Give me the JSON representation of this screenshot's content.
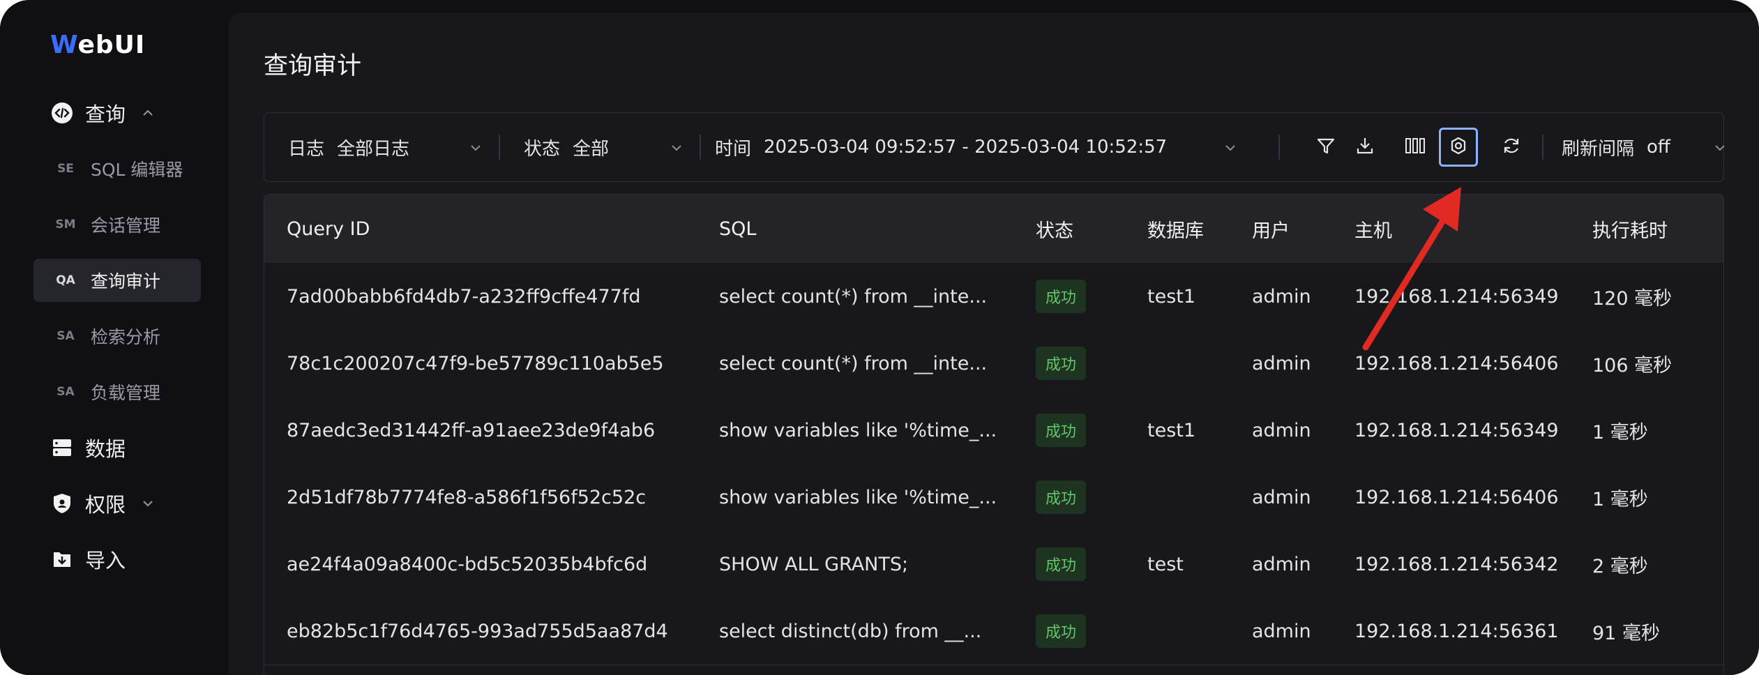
{
  "app": {
    "logo_first": "W",
    "logo_rest": "ebUI"
  },
  "sidebar": {
    "items": [
      {
        "label": "查询"
      },
      {
        "abbr": "SE",
        "label": "SQL 编辑器"
      },
      {
        "abbr": "SM",
        "label": "会话管理"
      },
      {
        "abbr": "QA",
        "label": "查询审计"
      },
      {
        "abbr": "SA",
        "label": "检索分析"
      },
      {
        "abbr": "SA",
        "label": "负载管理"
      },
      {
        "label": "数据"
      },
      {
        "label": "权限"
      },
      {
        "label": "导入"
      }
    ]
  },
  "page": {
    "title": "查询审计"
  },
  "toolbar": {
    "log_label": "日志",
    "log_value": "全部日志",
    "status_label": "状态",
    "status_value": "全部",
    "time_label": "时间",
    "time_value": "2025-03-04 09:52:57 - 2025-03-04 10:52:57",
    "refresh_label": "刷新间隔",
    "refresh_value": "off"
  },
  "table": {
    "columns": [
      "Query ID",
      "SQL",
      "状态",
      "数据库",
      "用户",
      "主机",
      "执行耗时"
    ],
    "rows": [
      {
        "id": "7ad00babb6fd4db7-a232ff9cffe477fd",
        "sql": "select count(*) from __inte...",
        "status": "成功",
        "db": "test1",
        "user": "admin",
        "host": "192.168.1.214:56349",
        "time": "120 毫秒"
      },
      {
        "id": "78c1c200207c47f9-be57789c110ab5e5",
        "sql": "select count(*) from __inte...",
        "status": "成功",
        "db": "",
        "user": "admin",
        "host": "192.168.1.214:56406",
        "time": "106 毫秒"
      },
      {
        "id": "87aedc3ed31442ff-a91aee23de9f4ab6",
        "sql": "show variables like '%time_...",
        "status": "成功",
        "db": "test1",
        "user": "admin",
        "host": "192.168.1.214:56349",
        "time": "1 毫秒"
      },
      {
        "id": "2d51df78b7774fe8-a586f1f56f52c52c",
        "sql": "show variables like '%time_...",
        "status": "成功",
        "db": "",
        "user": "admin",
        "host": "192.168.1.214:56406",
        "time": "1 毫秒"
      },
      {
        "id": "ae24f4a09a8400c-bd5c52035b4bfc6d",
        "sql": "SHOW ALL GRANTS;",
        "status": "成功",
        "db": "test",
        "user": "admin",
        "host": "192.168.1.214:56342",
        "time": "2 毫秒"
      },
      {
        "id": "eb82b5c1f76d4765-993ad755d5aa87d4",
        "sql": "select distinct(db) from __...",
        "status": "成功",
        "db": "",
        "user": "admin",
        "host": "192.168.1.214:56361",
        "time": "91 毫秒"
      }
    ]
  },
  "colors": {
    "accent": "#3b6bff",
    "success": "#63c56b",
    "annotation": "#e02a22",
    "focus": "#8ab4ff"
  }
}
